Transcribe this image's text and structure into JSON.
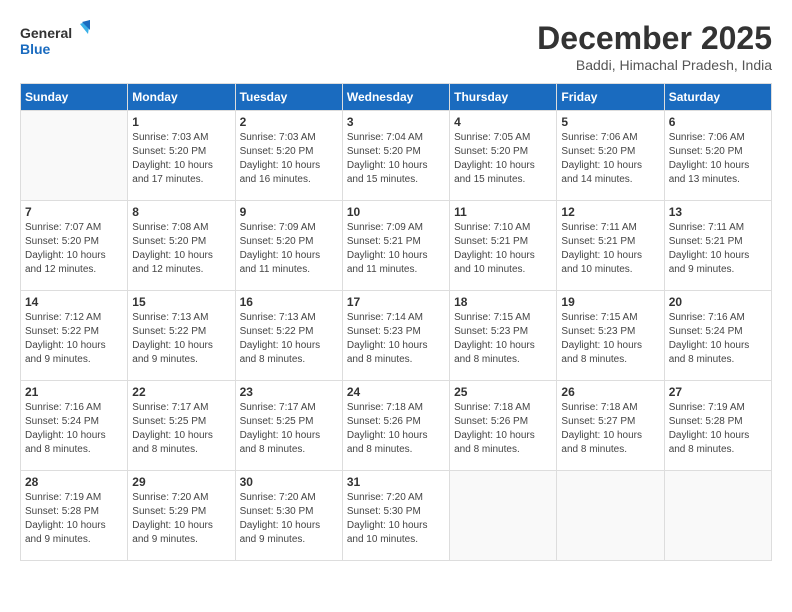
{
  "header": {
    "logo_line1": "General",
    "logo_line2": "Blue",
    "month_title": "December 2025",
    "location": "Baddi, Himachal Pradesh, India"
  },
  "days_of_week": [
    "Sunday",
    "Monday",
    "Tuesday",
    "Wednesday",
    "Thursday",
    "Friday",
    "Saturday"
  ],
  "weeks": [
    [
      {
        "day": "",
        "info": ""
      },
      {
        "day": "1",
        "info": "Sunrise: 7:03 AM\nSunset: 5:20 PM\nDaylight: 10 hours\nand 17 minutes."
      },
      {
        "day": "2",
        "info": "Sunrise: 7:03 AM\nSunset: 5:20 PM\nDaylight: 10 hours\nand 16 minutes."
      },
      {
        "day": "3",
        "info": "Sunrise: 7:04 AM\nSunset: 5:20 PM\nDaylight: 10 hours\nand 15 minutes."
      },
      {
        "day": "4",
        "info": "Sunrise: 7:05 AM\nSunset: 5:20 PM\nDaylight: 10 hours\nand 15 minutes."
      },
      {
        "day": "5",
        "info": "Sunrise: 7:06 AM\nSunset: 5:20 PM\nDaylight: 10 hours\nand 14 minutes."
      },
      {
        "day": "6",
        "info": "Sunrise: 7:06 AM\nSunset: 5:20 PM\nDaylight: 10 hours\nand 13 minutes."
      }
    ],
    [
      {
        "day": "7",
        "info": "Sunrise: 7:07 AM\nSunset: 5:20 PM\nDaylight: 10 hours\nand 12 minutes."
      },
      {
        "day": "8",
        "info": "Sunrise: 7:08 AM\nSunset: 5:20 PM\nDaylight: 10 hours\nand 12 minutes."
      },
      {
        "day": "9",
        "info": "Sunrise: 7:09 AM\nSunset: 5:20 PM\nDaylight: 10 hours\nand 11 minutes."
      },
      {
        "day": "10",
        "info": "Sunrise: 7:09 AM\nSunset: 5:21 PM\nDaylight: 10 hours\nand 11 minutes."
      },
      {
        "day": "11",
        "info": "Sunrise: 7:10 AM\nSunset: 5:21 PM\nDaylight: 10 hours\nand 10 minutes."
      },
      {
        "day": "12",
        "info": "Sunrise: 7:11 AM\nSunset: 5:21 PM\nDaylight: 10 hours\nand 10 minutes."
      },
      {
        "day": "13",
        "info": "Sunrise: 7:11 AM\nSunset: 5:21 PM\nDaylight: 10 hours\nand 9 minutes."
      }
    ],
    [
      {
        "day": "14",
        "info": "Sunrise: 7:12 AM\nSunset: 5:22 PM\nDaylight: 10 hours\nand 9 minutes."
      },
      {
        "day": "15",
        "info": "Sunrise: 7:13 AM\nSunset: 5:22 PM\nDaylight: 10 hours\nand 9 minutes."
      },
      {
        "day": "16",
        "info": "Sunrise: 7:13 AM\nSunset: 5:22 PM\nDaylight: 10 hours\nand 8 minutes."
      },
      {
        "day": "17",
        "info": "Sunrise: 7:14 AM\nSunset: 5:23 PM\nDaylight: 10 hours\nand 8 minutes."
      },
      {
        "day": "18",
        "info": "Sunrise: 7:15 AM\nSunset: 5:23 PM\nDaylight: 10 hours\nand 8 minutes."
      },
      {
        "day": "19",
        "info": "Sunrise: 7:15 AM\nSunset: 5:23 PM\nDaylight: 10 hours\nand 8 minutes."
      },
      {
        "day": "20",
        "info": "Sunrise: 7:16 AM\nSunset: 5:24 PM\nDaylight: 10 hours\nand 8 minutes."
      }
    ],
    [
      {
        "day": "21",
        "info": "Sunrise: 7:16 AM\nSunset: 5:24 PM\nDaylight: 10 hours\nand 8 minutes."
      },
      {
        "day": "22",
        "info": "Sunrise: 7:17 AM\nSunset: 5:25 PM\nDaylight: 10 hours\nand 8 minutes."
      },
      {
        "day": "23",
        "info": "Sunrise: 7:17 AM\nSunset: 5:25 PM\nDaylight: 10 hours\nand 8 minutes."
      },
      {
        "day": "24",
        "info": "Sunrise: 7:18 AM\nSunset: 5:26 PM\nDaylight: 10 hours\nand 8 minutes."
      },
      {
        "day": "25",
        "info": "Sunrise: 7:18 AM\nSunset: 5:26 PM\nDaylight: 10 hours\nand 8 minutes."
      },
      {
        "day": "26",
        "info": "Sunrise: 7:18 AM\nSunset: 5:27 PM\nDaylight: 10 hours\nand 8 minutes."
      },
      {
        "day": "27",
        "info": "Sunrise: 7:19 AM\nSunset: 5:28 PM\nDaylight: 10 hours\nand 8 minutes."
      }
    ],
    [
      {
        "day": "28",
        "info": "Sunrise: 7:19 AM\nSunset: 5:28 PM\nDaylight: 10 hours\nand 9 minutes."
      },
      {
        "day": "29",
        "info": "Sunrise: 7:20 AM\nSunset: 5:29 PM\nDaylight: 10 hours\nand 9 minutes."
      },
      {
        "day": "30",
        "info": "Sunrise: 7:20 AM\nSunset: 5:30 PM\nDaylight: 10 hours\nand 9 minutes."
      },
      {
        "day": "31",
        "info": "Sunrise: 7:20 AM\nSunset: 5:30 PM\nDaylight: 10 hours\nand 10 minutes."
      },
      {
        "day": "",
        "info": ""
      },
      {
        "day": "",
        "info": ""
      },
      {
        "day": "",
        "info": ""
      }
    ]
  ]
}
